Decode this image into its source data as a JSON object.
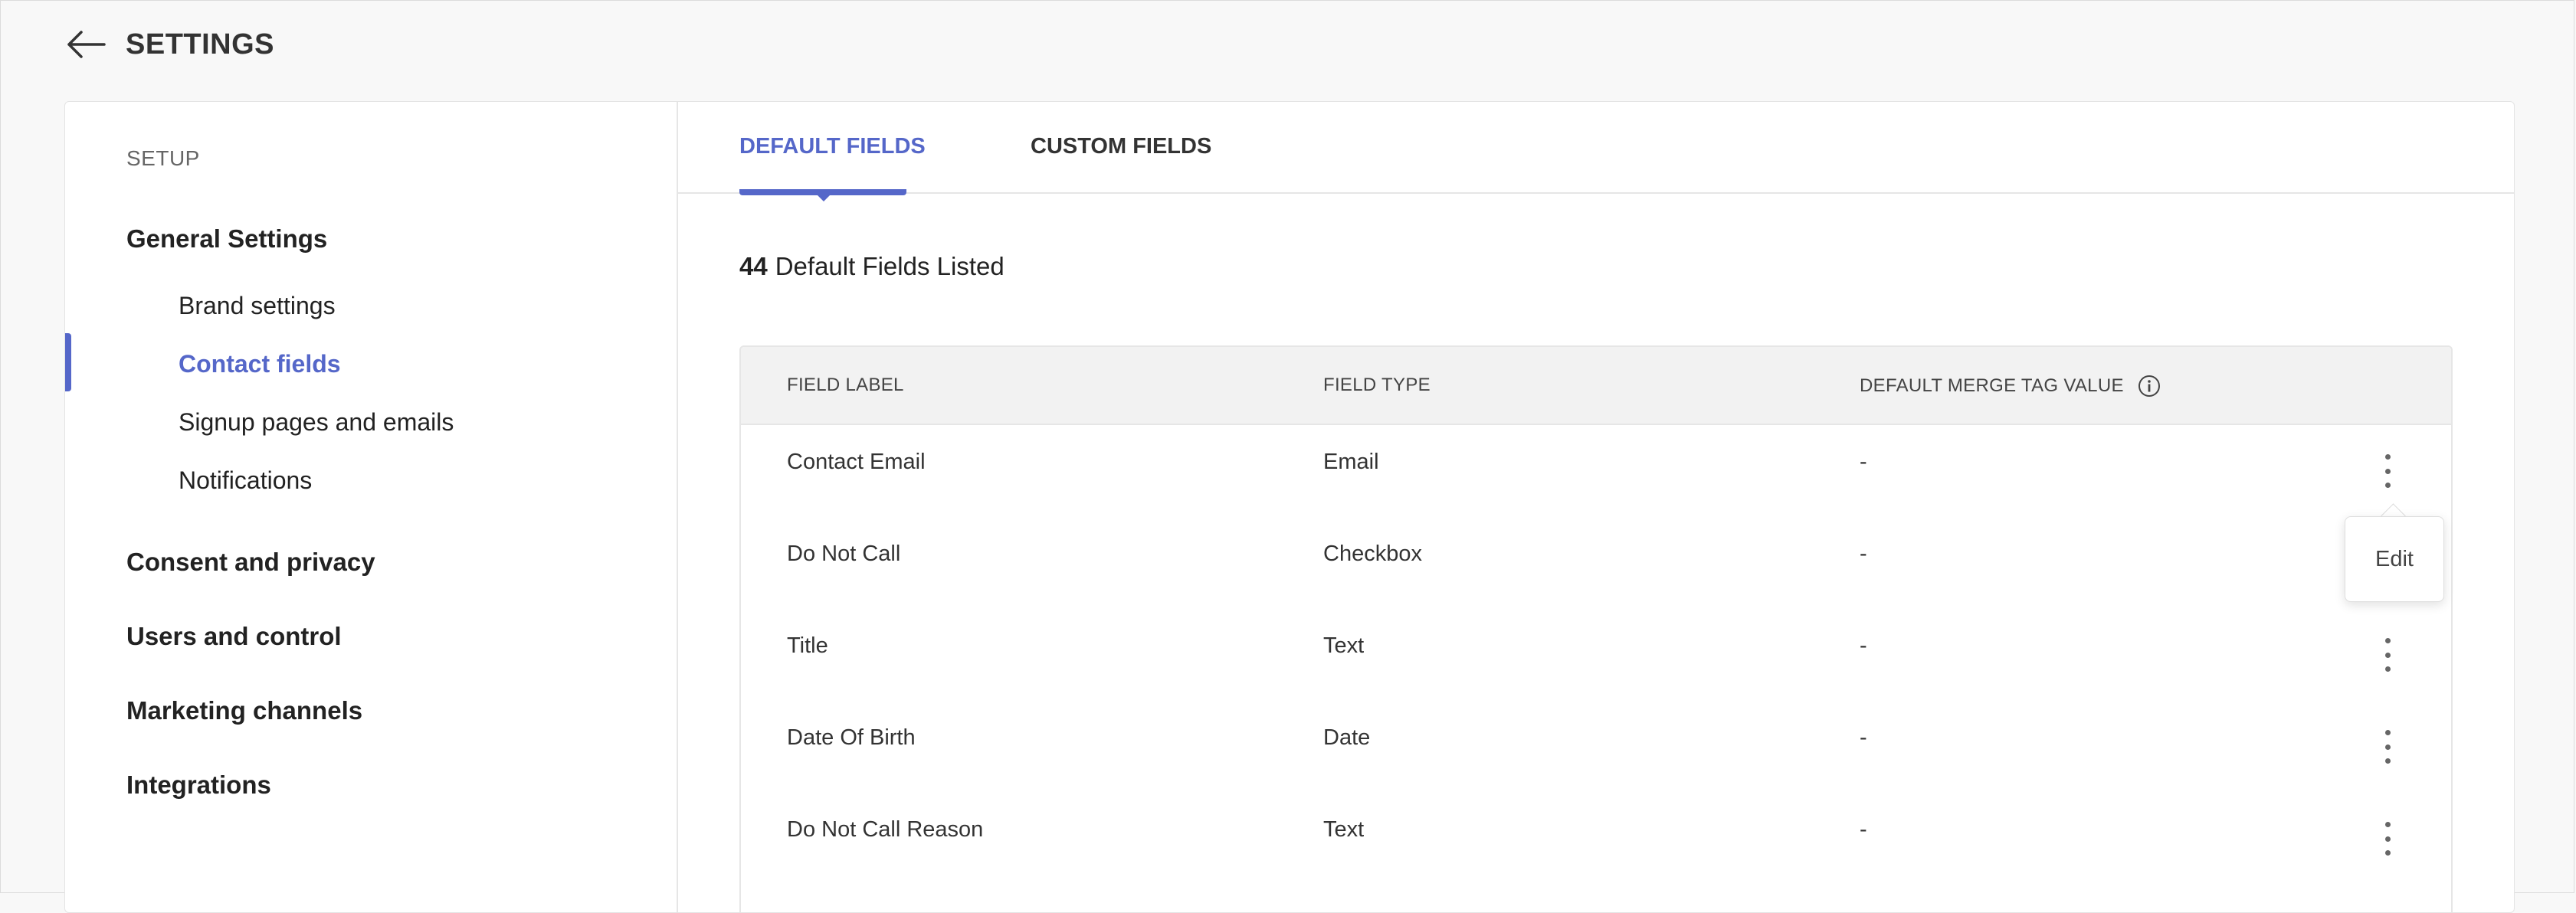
{
  "header": {
    "title": "SETTINGS"
  },
  "sidebar": {
    "heading": "SETUP",
    "groups": [
      {
        "label": "General Settings"
      },
      {
        "label": "Consent and privacy"
      },
      {
        "label": "Users and control"
      },
      {
        "label": "Marketing channels"
      },
      {
        "label": "Integrations"
      }
    ],
    "sub_items": [
      {
        "label": "Brand settings"
      },
      {
        "label": "Contact fields"
      },
      {
        "label": "Signup pages and emails"
      },
      {
        "label": "Notifications"
      }
    ]
  },
  "tabs": [
    {
      "label": "DEFAULT FIELDS"
    },
    {
      "label": "CUSTOM FIELDS"
    }
  ],
  "summary": {
    "count": "44",
    "text": "Default Fields Listed"
  },
  "table": {
    "headers": [
      "FIELD LABEL",
      "FIELD TYPE",
      "DEFAULT MERGE TAG VALUE"
    ],
    "rows": [
      {
        "label": "Contact Email",
        "type": "Email",
        "merge": "-"
      },
      {
        "label": "Do Not Call",
        "type": "Checkbox",
        "merge": "-"
      },
      {
        "label": "Title",
        "type": "Text",
        "merge": "-"
      },
      {
        "label": "Date Of Birth",
        "type": "Date",
        "merge": "-"
      },
      {
        "label": "Do Not Call Reason",
        "type": "Text",
        "merge": "-"
      }
    ]
  },
  "row_menu": {
    "edit_label": "Edit"
  },
  "colors": {
    "accent": "#5567c9"
  }
}
